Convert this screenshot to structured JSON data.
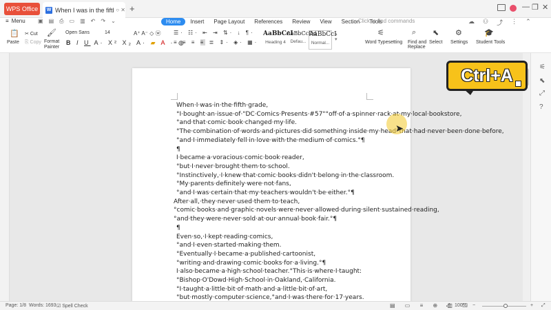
{
  "titlebar": {
    "app_tab": "WPS Office",
    "doc_tab": "When I was in the fifth grade",
    "new_tab": "+"
  },
  "menubar": {
    "menu_label": "Menu",
    "tabs": [
      "Home",
      "Insert",
      "Page Layout",
      "References",
      "Review",
      "View",
      "Section",
      "Tools"
    ],
    "active_tab": "Home",
    "search_placeholder": "Click to find commands"
  },
  "ribbon": {
    "paste": "Paste",
    "cut": "Cut",
    "copy": "Copy",
    "format_painter": "Format\nPainter",
    "font_name": "Open Sans",
    "font_size": "14",
    "styles": [
      {
        "preview": "AaBbCcI",
        "caption": "Heading 4"
      },
      {
        "preview": "AaBbCcDd",
        "caption": "Defau..."
      },
      {
        "preview": "AaBbCcI",
        "caption": "Normal..."
      }
    ],
    "word_typesetting": "Word Typesetting",
    "find_replace": "Find and\nReplace",
    "select": "Select",
    "settings": "Settings",
    "student_tools": "Student Tools"
  },
  "badge": {
    "label": "Ctrl+A"
  },
  "document": {
    "paragraphs": [
      "When·I·was·in·the·fifth·grade,°I·bought·an·issue·of·\"DC·Comics·Presents·#57\"°off·of·a·spinner·rack·at·my·local·bookstore,°and·that·comic·book·changed·my·life.°The·combination·of·words·and·pictures·did·something·inside·my·head°that·had·never·been·done·before,°and·I·immediately·fell·in·love·with·the·medium·of·comics.°¶",
      "¶",
      "I·became·a·voracious·comic·book·reader,°but·I·never·brought·them·to·school.°Instinctively,·I·knew·that·comic·books·didn't·belong·in·the·classroom.°My·parents·definitely·were·not·fans,°and·I·was·certain·that·my·teachers·wouldn't·be·either.°¶",
      "After·all,·they·never·used·them·to·teach,°comic·books·and·graphic·novels·were·never·allowed·during·silent·sustained·reading,°and·they·were·never·sold·at·our·annual·book·fair.°¶",
      "¶",
      "Even·so,·I·kept·reading·comics,°and·I·even·started·making·them.°Eventually·I·became·a·published·cartoonist,°writing·and·drawing·comic·books·for·a·living.°¶",
      "I·also·became·a·high·school·teacher.°This·is·where·I·taught:°Bishop·O'Dowd·High·School·in·Oakland,·California.°I·taught·a·little·bit·of·math·and·a·little·bit·of·art,°but·mostly·computer·science,°and·I·was·there·for·17·years.°¶",
      "¶"
    ]
  },
  "statusbar": {
    "page": "Page: 1/8",
    "words": "Words: 1693",
    "spell_check": "Spell Check",
    "zoom": "100%"
  }
}
